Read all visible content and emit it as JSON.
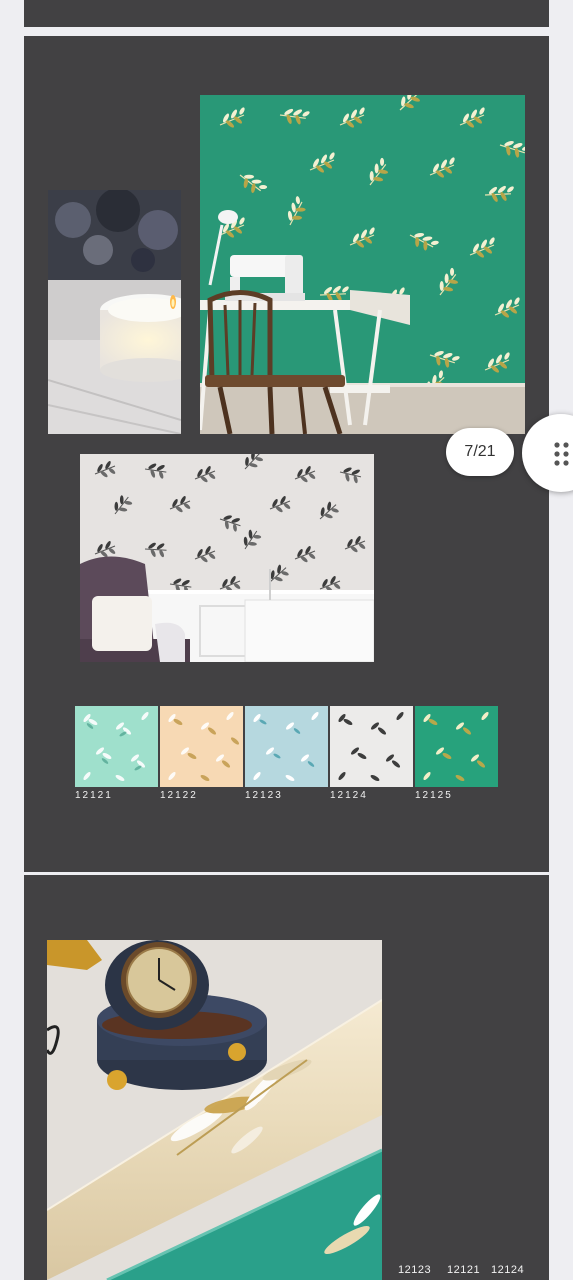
{
  "gallery": {
    "counter_text": "7/21",
    "menu_icon": "dots-grid-icon"
  },
  "colors": {
    "page_bg": "#eeeef2",
    "panel_bg": "#424143",
    "accent_green": "#2fa17f"
  },
  "swatches": [
    {
      "code": "12121",
      "color": "#9fe0cc",
      "leaf": "#ffffff"
    },
    {
      "code": "12122",
      "color": "#f7d9b4",
      "leaf": "#c9a35a"
    },
    {
      "code": "12123",
      "color": "#b6d8df",
      "leaf": "#ffffff"
    },
    {
      "code": "12124",
      "color": "#ecebea",
      "leaf": "#3d3d3d"
    },
    {
      "code": "12125",
      "color": "#27a27c",
      "leaf": "#d8d08a"
    }
  ],
  "roll_codes": [
    "12123",
    "12121",
    "12124"
  ]
}
